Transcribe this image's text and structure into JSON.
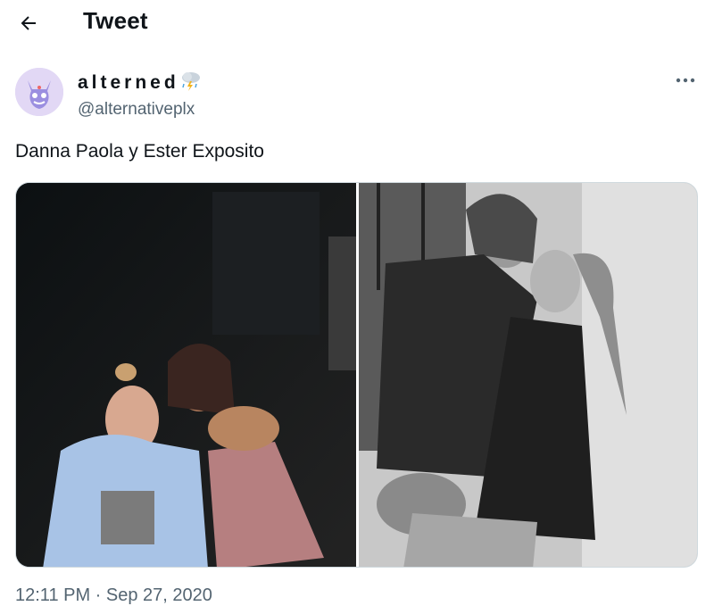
{
  "header": {
    "title": "Tweet",
    "back_icon": "arrow-left-icon"
  },
  "author": {
    "display_name": "alterned",
    "display_emoji": "cloud-with-lightning-and-rain",
    "handle": "@alternativeplx",
    "avatar_icon": "oni-mask-avatar"
  },
  "tweet": {
    "text": "Danna Paola y Ester Exposito",
    "timestamp": "12:11 PM · Sep 27, 2020"
  },
  "media": [
    {
      "description_icon": "photo-color"
    },
    {
      "description_icon": "photo-black-and-white"
    }
  ],
  "colors": {
    "text": "#0f1419",
    "secondary": "#536471",
    "border": "#cfd9de"
  }
}
